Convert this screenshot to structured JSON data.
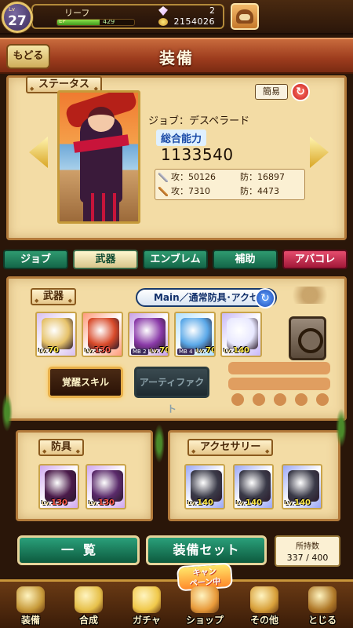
{
  "topbar": {
    "level_tag": "Lv",
    "level": "27",
    "player_name": "リーフ",
    "ep_label": "EP",
    "ep_value": "429",
    "ep_progress": 0.55,
    "gem_count": "2",
    "coin_count": "2154026",
    "book_icon": "guide-book-icon"
  },
  "header": {
    "back_label": "もどる",
    "title": "装備"
  },
  "status": {
    "section_label": "ステータス",
    "simple_label": "簡易",
    "job_line": "ジョブ：デスペラード",
    "power_label": "総合能力",
    "power_value": "1133540",
    "physical": {
      "atk": "攻：50126",
      "def": "防：16897"
    },
    "magical": {
      "atk": "攻：7310",
      "def": "防：4473"
    }
  },
  "tabs": [
    {
      "label": "ジョブ",
      "active": false
    },
    {
      "label": "武器",
      "active": true
    },
    {
      "label": "エンブレム",
      "active": false
    },
    {
      "label": "補助",
      "active": false
    },
    {
      "label": "アバコレ",
      "active": false
    }
  ],
  "weapons": {
    "section_label": "武器",
    "mode_label": "Main／通常防具･アクセ",
    "awaken_skill_label": "覚醒スキル",
    "artifact_label": "アーティファクト",
    "items": [
      {
        "lv_tag": "Lv.",
        "lv": "70",
        "mb": "",
        "level_color": "yellow",
        "frame": "#d8c0f0",
        "art": "#e6c26a"
      },
      {
        "lv_tag": "Lv.",
        "lv": "130",
        "mb": "",
        "level_color": "red",
        "frame": "#ff9a7a",
        "art": "#d84a2a"
      },
      {
        "lv_tag": "Lv.",
        "lv": "70",
        "mb": "MB 2",
        "level_color": "yellow",
        "frame": "#c8a0e8",
        "art": "#8a3aa8"
      },
      {
        "lv_tag": "Lv.",
        "lv": "70",
        "mb": "MB 4",
        "level_color": "yellow",
        "frame": "#b0e0ff",
        "art": "#5aa8e8"
      },
      {
        "lv_tag": "Lv.",
        "lv": "140",
        "mb": "",
        "level_color": "yellow",
        "frame": "#c8b8f8",
        "art": "#e8e8ff"
      }
    ]
  },
  "armor": {
    "section_label": "防具",
    "items": [
      {
        "lv_tag": "Lv.",
        "lv": "130",
        "level_color": "red",
        "frame": "#d0a8f0",
        "art": "#4a1a4a"
      },
      {
        "lv_tag": "Lv.",
        "lv": "130",
        "level_color": "red",
        "frame": "#d0a8f0",
        "art": "#5a2a6a"
      }
    ]
  },
  "accessory": {
    "section_label": "アクセサリー",
    "items": [
      {
        "lv_tag": "Lv.",
        "lv": "140",
        "level_color": "yellow",
        "frame": "#9aa8f8",
        "art": "#3a3a48"
      },
      {
        "lv_tag": "Lv.",
        "lv": "140",
        "level_color": "yellow",
        "frame": "#9aa8f8",
        "art": "#3a3a48"
      },
      {
        "lv_tag": "Lv.",
        "lv": "140",
        "level_color": "yellow",
        "frame": "#9aa8f8",
        "art": "#3a3a48"
      }
    ]
  },
  "actions": {
    "list_label": "一覧",
    "set_label": "装備セット",
    "owned_label": "所持数",
    "owned_value": "337 / 400"
  },
  "nav": {
    "campaign_badge_line1": "キャン",
    "campaign_badge_line2": "ペーン中",
    "items": [
      {
        "label": "装備",
        "icon": "equip-scroll-icon",
        "color": "#c79a3a"
      },
      {
        "label": "合成",
        "icon": "hammer-icon",
        "color": "#e6c04a"
      },
      {
        "label": "ガチャ",
        "icon": "gacha-ticket-icon",
        "color": "#f0c84a"
      },
      {
        "label": "ショップ",
        "icon": "shop-bag-icon",
        "color": "#e89a3a"
      },
      {
        "label": "その他",
        "icon": "gear-icon",
        "color": "#d8a03a"
      },
      {
        "label": "とじる",
        "icon": "close-frog-icon",
        "color": "#b07a2a"
      }
    ]
  }
}
